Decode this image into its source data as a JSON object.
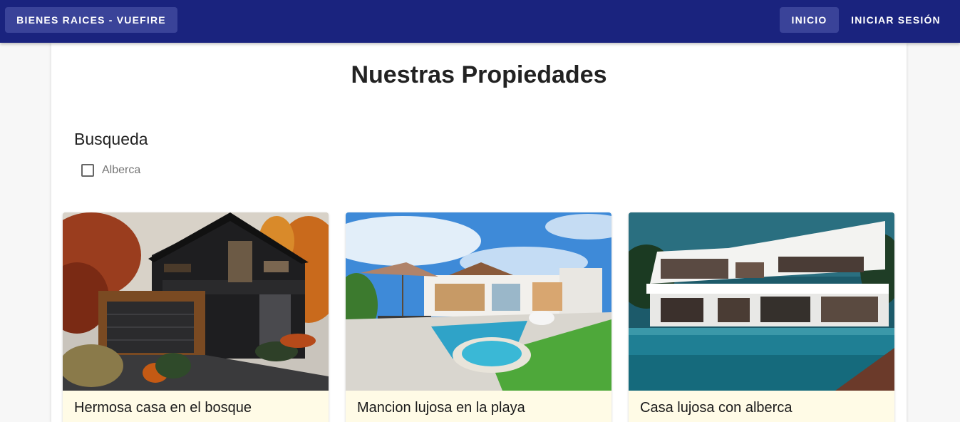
{
  "appbar": {
    "brand": "BIENES RAICES - VUEFIRE",
    "nav": [
      {
        "label": "INICIO",
        "active": true
      },
      {
        "label": "INICIAR SESIÓN",
        "active": false
      }
    ],
    "color": "#1a237e"
  },
  "page": {
    "title": "Nuestras Propiedades",
    "search": {
      "label": "Busqueda",
      "filters": [
        {
          "label": "Alberca",
          "checked": false
        }
      ]
    }
  },
  "properties": [
    {
      "title": "Hermosa casa en el bosque",
      "image": "dark-modern-house-forest"
    },
    {
      "title": "Mancion lujosa en la playa",
      "image": "white-villa-pool-beach"
    },
    {
      "title": "Casa lujosa con alberca",
      "image": "white-modern-house-pool"
    }
  ]
}
